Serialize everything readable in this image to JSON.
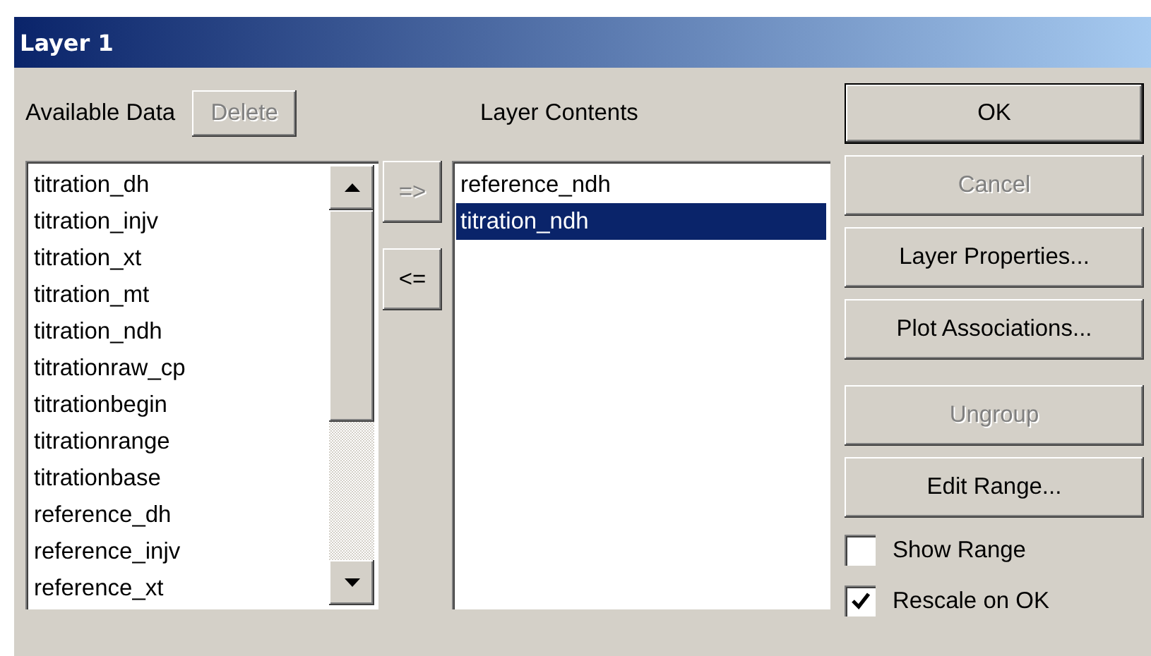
{
  "window": {
    "title": "Layer 1"
  },
  "available": {
    "label": "Available Data",
    "delete_button": {
      "label": "Delete",
      "disabled": true
    },
    "items": [
      {
        "label": "titration_dh",
        "selected": false
      },
      {
        "label": "titration_injv",
        "selected": false
      },
      {
        "label": "titration_xt",
        "selected": false
      },
      {
        "label": "titration_mt",
        "selected": false
      },
      {
        "label": "titration_ndh",
        "selected": false
      },
      {
        "label": "titrationraw_cp",
        "selected": false
      },
      {
        "label": "titrationbegin",
        "selected": false
      },
      {
        "label": "titrationrange",
        "selected": false
      },
      {
        "label": "titrationbase",
        "selected": false
      },
      {
        "label": "reference_dh",
        "selected": false
      },
      {
        "label": "reference_injv",
        "selected": false
      },
      {
        "label": "reference_xt",
        "selected": false
      }
    ]
  },
  "move_buttons": [
    {
      "label": "=>",
      "disabled": true
    },
    {
      "label": "<=",
      "disabled": false
    }
  ],
  "contents": {
    "label": "Layer Contents",
    "items": [
      {
        "label": "reference_ndh",
        "selected": false
      },
      {
        "label": "titration_ndh",
        "selected": true
      }
    ]
  },
  "buttons": [
    {
      "label": "OK",
      "disabled": false,
      "default": true
    },
    {
      "label": "Cancel",
      "disabled": true,
      "default": false
    },
    {
      "label": "Layer Properties...",
      "disabled": false,
      "default": false
    },
    {
      "label": "Plot Associations...",
      "disabled": false,
      "default": false
    },
    {
      "label": "Ungroup",
      "disabled": true,
      "default": false
    },
    {
      "label": "Edit Range...",
      "disabled": false,
      "default": false
    }
  ],
  "checkboxes": [
    {
      "label": "Show Range",
      "checked": false
    },
    {
      "label": "Rescale on OK",
      "checked": true
    }
  ]
}
